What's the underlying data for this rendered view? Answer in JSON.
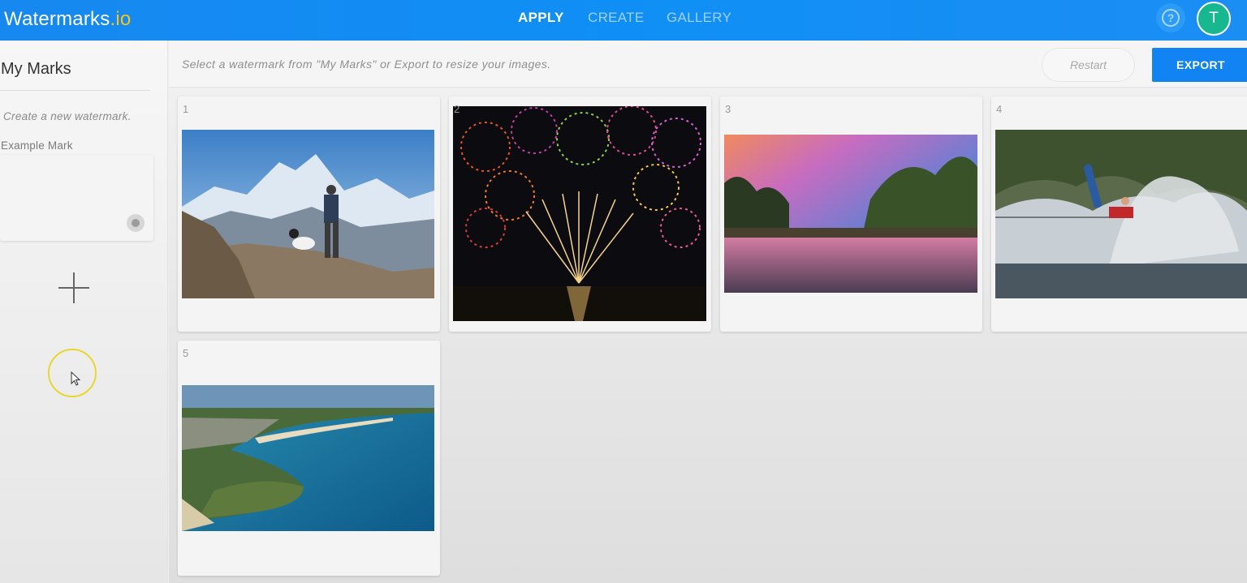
{
  "header": {
    "logo_main": "Watermarks",
    "logo_tld": ".io",
    "nav": [
      {
        "label": "APPLY",
        "active": true
      },
      {
        "label": "CREATE",
        "active": false
      },
      {
        "label": "GALLERY",
        "active": false
      }
    ],
    "help_icon": "question-circle-icon",
    "help_glyph": "?",
    "avatar_initial": "T",
    "colors": {
      "bar": "#1788f0",
      "logo_accent": "#f5c518",
      "avatar": "#17b890"
    }
  },
  "sidebar": {
    "title": "My Marks",
    "hint": "Create a new watermark.",
    "mark_label": "Example Mark",
    "add_icon": "plus-icon"
  },
  "toolbar": {
    "hint": "Select a watermark from \"My Marks\" or Export to resize your images.",
    "restart_label": "Restart",
    "export_label": "EXPORT",
    "colors": {
      "export": "#1183f2"
    }
  },
  "gallery": {
    "images": [
      {
        "number": "1",
        "subject": "hiker with dog on mountain ridge"
      },
      {
        "number": "2",
        "subject": "fireworks over water at night"
      },
      {
        "number": "3",
        "subject": "sunset over river with trees"
      },
      {
        "number": "4",
        "subject": "wakeboarder jumping with water spray"
      },
      {
        "number": "5",
        "subject": "aerial coastline with turquoise sea"
      }
    ]
  }
}
